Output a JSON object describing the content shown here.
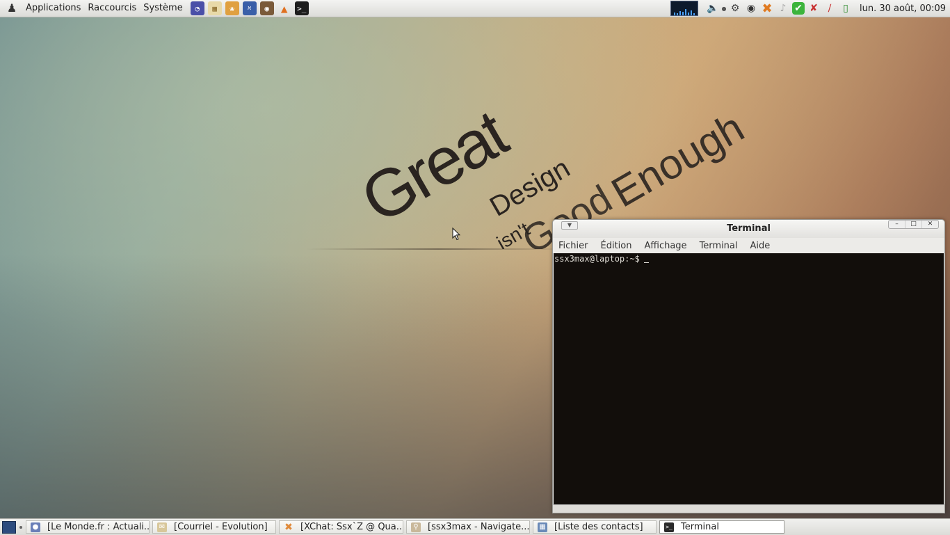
{
  "top_panel": {
    "menus": [
      "Applications",
      "Raccourcis",
      "Système"
    ],
    "launchers": [
      {
        "icon": "eclipse-icon"
      },
      {
        "icon": "notepad-icon"
      },
      {
        "icon": "graphics-icon"
      },
      {
        "icon": "translator-icon"
      },
      {
        "icon": "speaker-app-icon"
      },
      {
        "icon": "vlc-icon"
      },
      {
        "icon": "terminal-icon"
      }
    ],
    "tray": [
      "system-monitor-icon",
      "volume-icon",
      "dot-icon",
      "gear-icon",
      "chat-bubble-icon",
      "xchat-icon",
      "music-note-icon",
      "check-icon",
      "network-disabled-icon",
      "bluetooth-disabled-icon",
      "battery-icon"
    ],
    "clock": "lun. 30 août, 00:09"
  },
  "wallpaper": {
    "words": [
      "Great",
      "Design",
      "isn't",
      "Good",
      "Enough"
    ]
  },
  "terminal_window": {
    "title": "Terminal",
    "menu": [
      "Fichier",
      "Édition",
      "Affichage",
      "Terminal",
      "Aide"
    ],
    "prompt": "ssx3max@laptop:~$"
  },
  "taskbar": {
    "tasks": [
      {
        "label": "[Le Monde.fr : Actuali...",
        "icon": "firefox-icon",
        "color": "#6a7fb8"
      },
      {
        "label": "[Courriel - Evolution]",
        "icon": "mail-icon",
        "color": "#d8c79a"
      },
      {
        "label": "[XChat: Ssx`Z @ Qua...",
        "icon": "xchat-icon",
        "color": "#e08a3a"
      },
      {
        "label": "[ssx3max - Navigate...",
        "icon": "file-browser-icon",
        "color": "#c9b89a"
      },
      {
        "label": "[Liste des contacts]",
        "icon": "contacts-icon",
        "color": "#6a8ab8"
      },
      {
        "label": "Terminal",
        "icon": "terminal-icon",
        "color": "#2a2a2a",
        "active": true
      }
    ]
  }
}
